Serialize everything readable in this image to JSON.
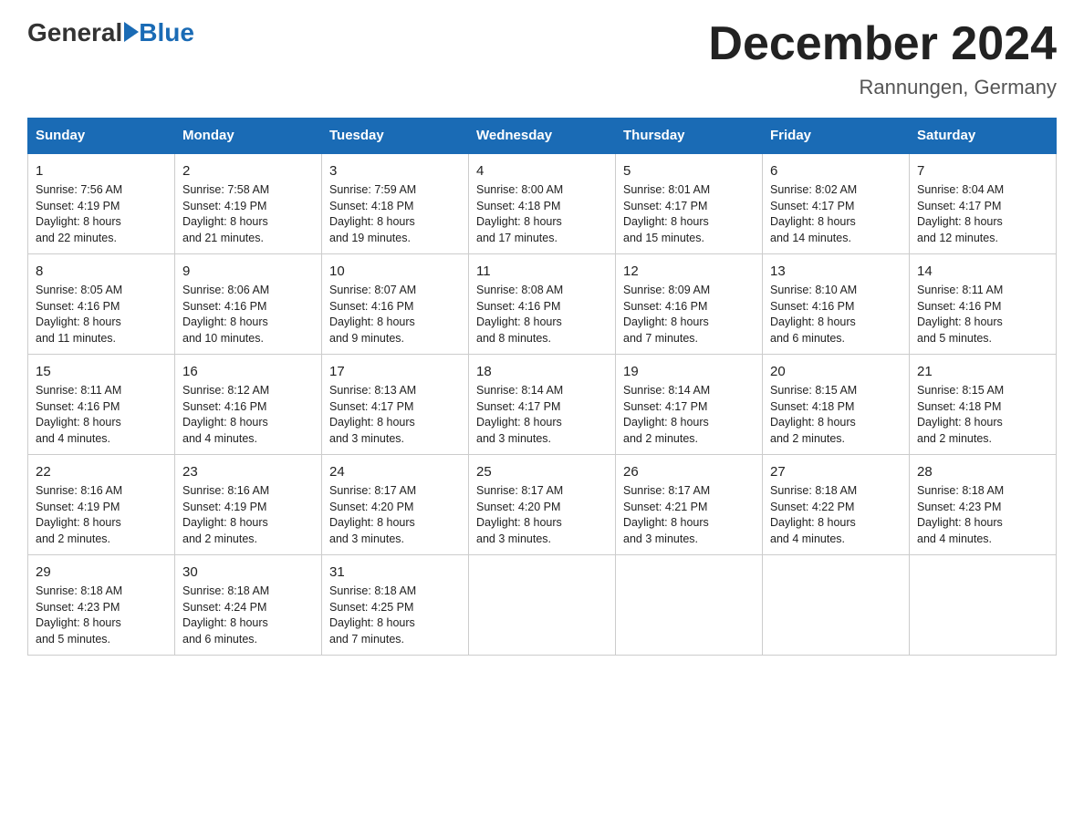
{
  "header": {
    "logo_general": "General",
    "logo_blue": "Blue",
    "title": "December 2024",
    "subtitle": "Rannungen, Germany"
  },
  "days_header": [
    "Sunday",
    "Monday",
    "Tuesday",
    "Wednesday",
    "Thursday",
    "Friday",
    "Saturday"
  ],
  "weeks": [
    [
      {
        "day": "1",
        "sunrise": "7:56 AM",
        "sunset": "4:19 PM",
        "daylight": "8 hours and 22 minutes."
      },
      {
        "day": "2",
        "sunrise": "7:58 AM",
        "sunset": "4:19 PM",
        "daylight": "8 hours and 21 minutes."
      },
      {
        "day": "3",
        "sunrise": "7:59 AM",
        "sunset": "4:18 PM",
        "daylight": "8 hours and 19 minutes."
      },
      {
        "day": "4",
        "sunrise": "8:00 AM",
        "sunset": "4:18 PM",
        "daylight": "8 hours and 17 minutes."
      },
      {
        "day": "5",
        "sunrise": "8:01 AM",
        "sunset": "4:17 PM",
        "daylight": "8 hours and 15 minutes."
      },
      {
        "day": "6",
        "sunrise": "8:02 AM",
        "sunset": "4:17 PM",
        "daylight": "8 hours and 14 minutes."
      },
      {
        "day": "7",
        "sunrise": "8:04 AM",
        "sunset": "4:17 PM",
        "daylight": "8 hours and 12 minutes."
      }
    ],
    [
      {
        "day": "8",
        "sunrise": "8:05 AM",
        "sunset": "4:16 PM",
        "daylight": "8 hours and 11 minutes."
      },
      {
        "day": "9",
        "sunrise": "8:06 AM",
        "sunset": "4:16 PM",
        "daylight": "8 hours and 10 minutes."
      },
      {
        "day": "10",
        "sunrise": "8:07 AM",
        "sunset": "4:16 PM",
        "daylight": "8 hours and 9 minutes."
      },
      {
        "day": "11",
        "sunrise": "8:08 AM",
        "sunset": "4:16 PM",
        "daylight": "8 hours and 8 minutes."
      },
      {
        "day": "12",
        "sunrise": "8:09 AM",
        "sunset": "4:16 PM",
        "daylight": "8 hours and 7 minutes."
      },
      {
        "day": "13",
        "sunrise": "8:10 AM",
        "sunset": "4:16 PM",
        "daylight": "8 hours and 6 minutes."
      },
      {
        "day": "14",
        "sunrise": "8:11 AM",
        "sunset": "4:16 PM",
        "daylight": "8 hours and 5 minutes."
      }
    ],
    [
      {
        "day": "15",
        "sunrise": "8:11 AM",
        "sunset": "4:16 PM",
        "daylight": "8 hours and 4 minutes."
      },
      {
        "day": "16",
        "sunrise": "8:12 AM",
        "sunset": "4:16 PM",
        "daylight": "8 hours and 4 minutes."
      },
      {
        "day": "17",
        "sunrise": "8:13 AM",
        "sunset": "4:17 PM",
        "daylight": "8 hours and 3 minutes."
      },
      {
        "day": "18",
        "sunrise": "8:14 AM",
        "sunset": "4:17 PM",
        "daylight": "8 hours and 3 minutes."
      },
      {
        "day": "19",
        "sunrise": "8:14 AM",
        "sunset": "4:17 PM",
        "daylight": "8 hours and 2 minutes."
      },
      {
        "day": "20",
        "sunrise": "8:15 AM",
        "sunset": "4:18 PM",
        "daylight": "8 hours and 2 minutes."
      },
      {
        "day": "21",
        "sunrise": "8:15 AM",
        "sunset": "4:18 PM",
        "daylight": "8 hours and 2 minutes."
      }
    ],
    [
      {
        "day": "22",
        "sunrise": "8:16 AM",
        "sunset": "4:19 PM",
        "daylight": "8 hours and 2 minutes."
      },
      {
        "day": "23",
        "sunrise": "8:16 AM",
        "sunset": "4:19 PM",
        "daylight": "8 hours and 2 minutes."
      },
      {
        "day": "24",
        "sunrise": "8:17 AM",
        "sunset": "4:20 PM",
        "daylight": "8 hours and 3 minutes."
      },
      {
        "day": "25",
        "sunrise": "8:17 AM",
        "sunset": "4:20 PM",
        "daylight": "8 hours and 3 minutes."
      },
      {
        "day": "26",
        "sunrise": "8:17 AM",
        "sunset": "4:21 PM",
        "daylight": "8 hours and 3 minutes."
      },
      {
        "day": "27",
        "sunrise": "8:18 AM",
        "sunset": "4:22 PM",
        "daylight": "8 hours and 4 minutes."
      },
      {
        "day": "28",
        "sunrise": "8:18 AM",
        "sunset": "4:23 PM",
        "daylight": "8 hours and 4 minutes."
      }
    ],
    [
      {
        "day": "29",
        "sunrise": "8:18 AM",
        "sunset": "4:23 PM",
        "daylight": "8 hours and 5 minutes."
      },
      {
        "day": "30",
        "sunrise": "8:18 AM",
        "sunset": "4:24 PM",
        "daylight": "8 hours and 6 minutes."
      },
      {
        "day": "31",
        "sunrise": "8:18 AM",
        "sunset": "4:25 PM",
        "daylight": "8 hours and 7 minutes."
      },
      null,
      null,
      null,
      null
    ]
  ],
  "labels": {
    "sunrise": "Sunrise:",
    "sunset": "Sunset:",
    "daylight": "Daylight:"
  }
}
